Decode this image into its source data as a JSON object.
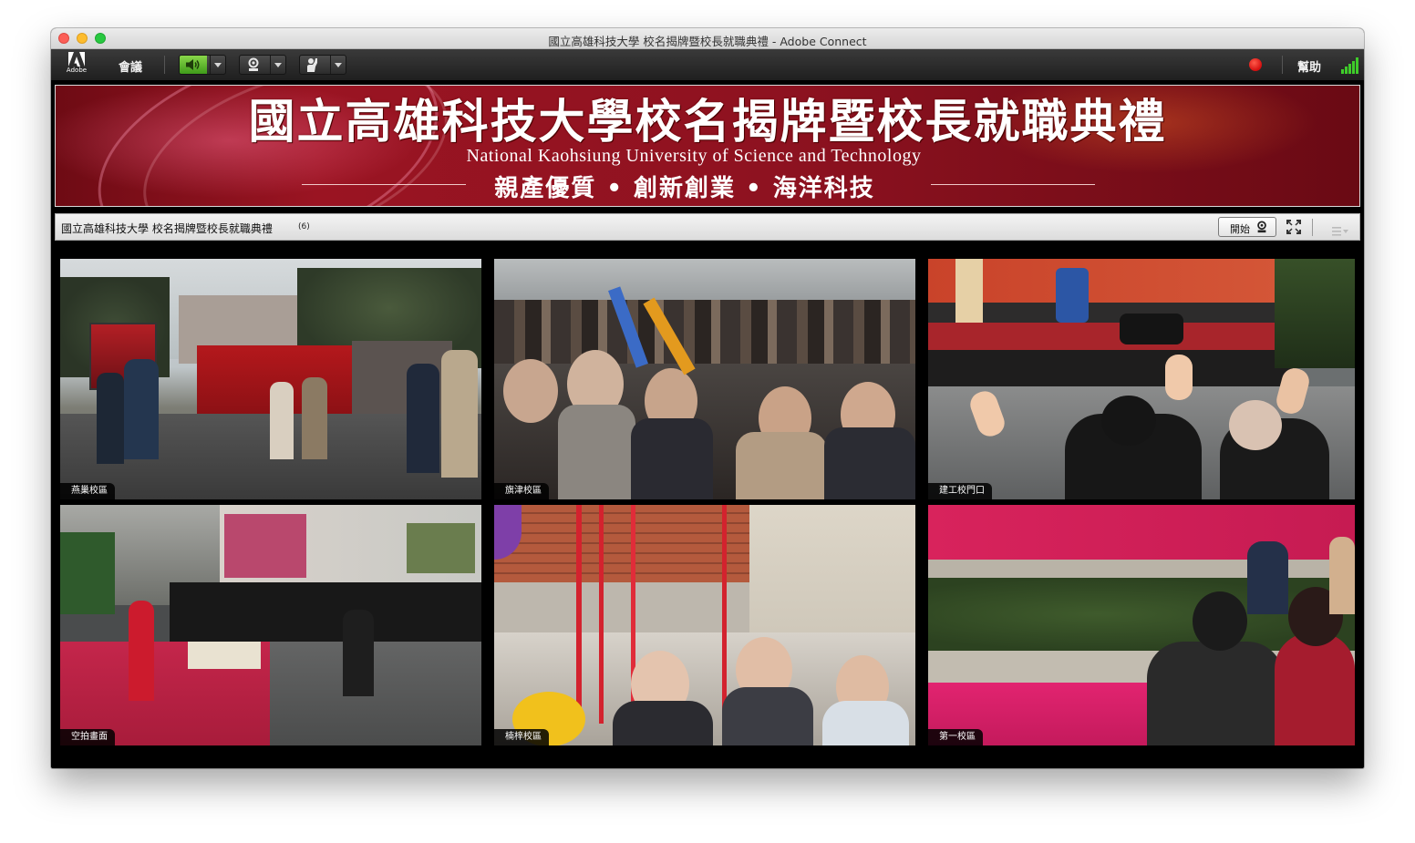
{
  "window": {
    "title": "國立高雄科技大學 校名揭牌暨校長就職典禮 - Adobe Connect"
  },
  "toolbar": {
    "logo_caption": "Adobe",
    "meeting_menu": "會議",
    "help_menu": "幫助",
    "icons": [
      "adobe-logo-icon",
      "speaker-icon",
      "webcam-icon",
      "raise-hand-icon",
      "record-indicator-icon",
      "connection-signal-icon"
    ]
  },
  "banner": {
    "title": "國立高雄科技大學校名揭牌暨校長就職典禮",
    "subtitle": "National Kaohsiung University of Science and Technology",
    "slogan": "親產優質 • 創新創業 • 海洋科技"
  },
  "pod": {
    "title": "國立高雄科技大學 校名揭牌暨校長就職典禮",
    "count": "(6)",
    "start_label": "開始"
  },
  "videos": [
    {
      "label": "燕巢校區"
    },
    {
      "label": "旗津校區"
    },
    {
      "label": "建工校門口"
    },
    {
      "label": "空拍畫面"
    },
    {
      "label": "楠梓校區"
    },
    {
      "label": "第一校區"
    }
  ],
  "colors": {
    "record": "#e01818",
    "speaker_active": "#5cb82a",
    "banner_bg": "#8e1220",
    "signal": "#3fcc2a"
  }
}
